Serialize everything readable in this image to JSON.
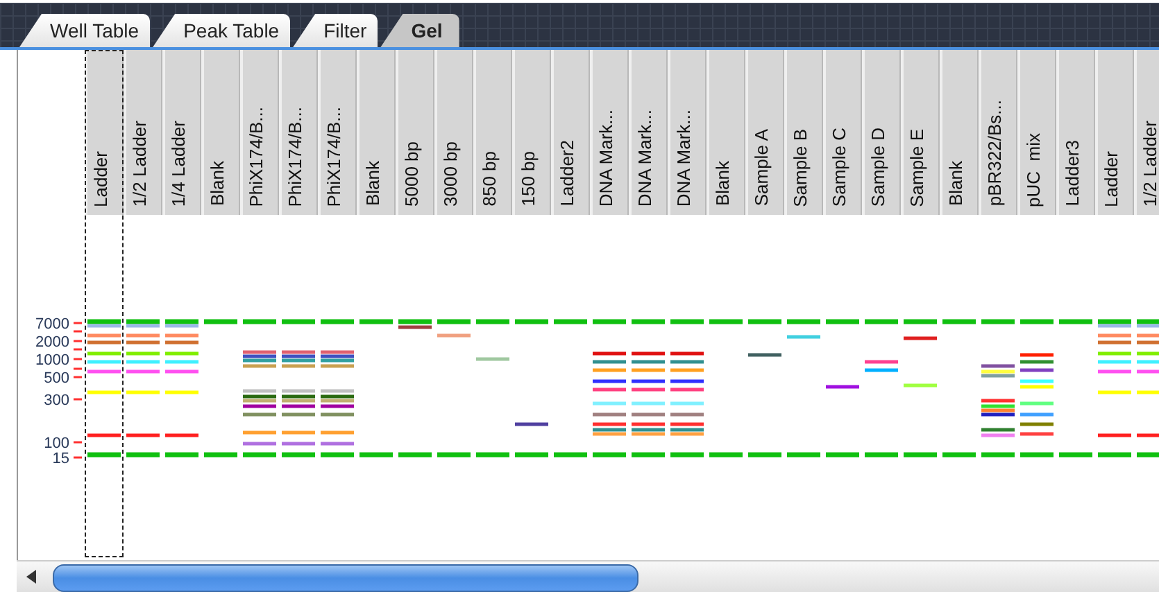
{
  "tabs": [
    {
      "label": "Well Table",
      "selected": false
    },
    {
      "label": "Peak Table",
      "selected": false
    },
    {
      "label": "Filter",
      "selected": false
    },
    {
      "label": "Gel",
      "selected": true
    }
  ],
  "gel": {
    "size_labels": [
      "7000",
      "2000",
      "1000",
      "500",
      "300",
      "100",
      "15"
    ],
    "lanes": [
      {
        "label": "Ladder",
        "selected": true
      },
      {
        "label": "1/2 Ladder",
        "selected": false
      },
      {
        "label": "1/4 Ladder",
        "selected": false
      },
      {
        "label": "Blank",
        "selected": false
      },
      {
        "label": "PhiX174/B...",
        "selected": false
      },
      {
        "label": "PhiX174/B...",
        "selected": false
      },
      {
        "label": "PhiX174/B...",
        "selected": false
      },
      {
        "label": "Blank",
        "selected": false
      },
      {
        "label": "5000 bp",
        "selected": false
      },
      {
        "label": "3000 bp",
        "selected": false
      },
      {
        "label": "850 bp",
        "selected": false
      },
      {
        "label": "150 bp",
        "selected": false
      },
      {
        "label": "Ladder2",
        "selected": false
      },
      {
        "label": "DNA Mark...",
        "selected": false
      },
      {
        "label": "DNA Mark...",
        "selected": false
      },
      {
        "label": "DNA Mark...",
        "selected": false
      },
      {
        "label": "Blank",
        "selected": false
      },
      {
        "label": "Sample A",
        "selected": false
      },
      {
        "label": "Sample B",
        "selected": false
      },
      {
        "label": "Sample C",
        "selected": false
      },
      {
        "label": "Sample D",
        "selected": false
      },
      {
        "label": "Sample E",
        "selected": false
      },
      {
        "label": "Blank",
        "selected": false
      },
      {
        "label": "pBR322/Bs...",
        "selected": false
      },
      {
        "label": "pUC  mix",
        "selected": false
      },
      {
        "label": "Ladder3",
        "selected": false
      },
      {
        "label": "Ladder",
        "selected": false
      },
      {
        "label": "1/2 Ladder",
        "selected": false
      }
    ]
  }
}
